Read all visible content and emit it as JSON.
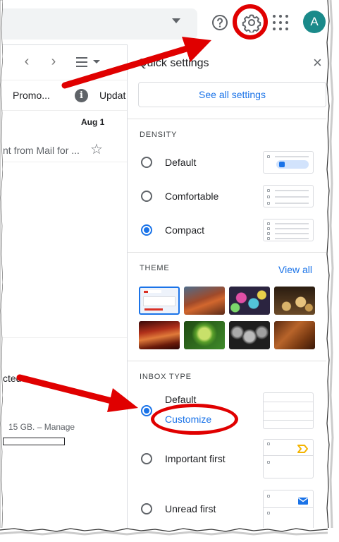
{
  "header": {
    "help_icon": "help-circle-icon",
    "settings_icon": "gear-icon",
    "apps_icon": "apps-grid-icon",
    "avatar_letter": "A",
    "avatar_color": "#1a8a8a"
  },
  "mail_list": {
    "tabs": [
      "Promo...",
      "Updat"
    ],
    "date": "Aug 1",
    "snippet": "nt from Mail for ...",
    "cut_text": "cted",
    "storage_text": "15 GB. – Manage",
    "storage_used": 0
  },
  "quick_settings": {
    "title": "Quick settings",
    "see_all_label": "See all settings",
    "density": {
      "label": "DENSITY",
      "options": [
        "Default",
        "Comfortable",
        "Compact"
      ],
      "selected": "Compact"
    },
    "theme": {
      "label": "THEME",
      "view_all_label": "View all",
      "selected_index": 0
    },
    "inbox_type": {
      "label": "INBOX TYPE",
      "options": [
        "Default",
        "Important first",
        "Unread first"
      ],
      "selected": "Default",
      "customize_label": "Customize"
    }
  },
  "colors": {
    "accent": "#1a73e8",
    "annotation_red": "#e00000"
  }
}
